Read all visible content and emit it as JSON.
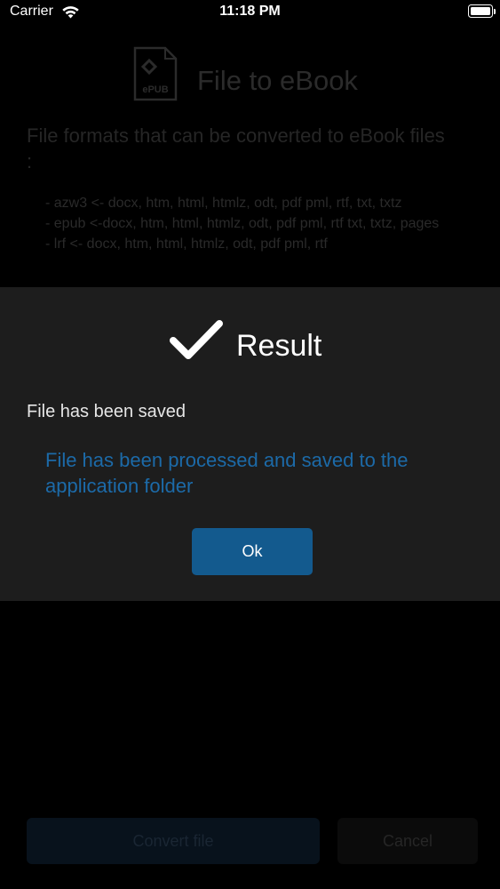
{
  "status_bar": {
    "carrier": "Carrier",
    "time": "11:18 PM"
  },
  "background": {
    "logo_label": "ePUB",
    "title": "File to eBook",
    "heading": "File formats that can be converted to eBook files :",
    "formats": [
      "- azw3 <- docx, htm, html, htmlz, odt, pdf pml, rtf, txt, txtz",
      "- epub <-docx, htm, html, htmlz, odt, pdf pml, rtf txt, txtz, pages",
      "- lrf <- docx, htm, html, htmlz, odt, pdf pml, rtf"
    ],
    "convert_button": "Convert file",
    "cancel_button": "Cancel"
  },
  "dialog": {
    "title": "Result",
    "subtitle": "File has been saved",
    "message": "File has been processed and saved to the application folder",
    "ok_button": "Ok",
    "colors": {
      "message": "#1c6aa8",
      "ok_button": "#135a8e",
      "dialog_bg": "#1d1d1d"
    }
  }
}
